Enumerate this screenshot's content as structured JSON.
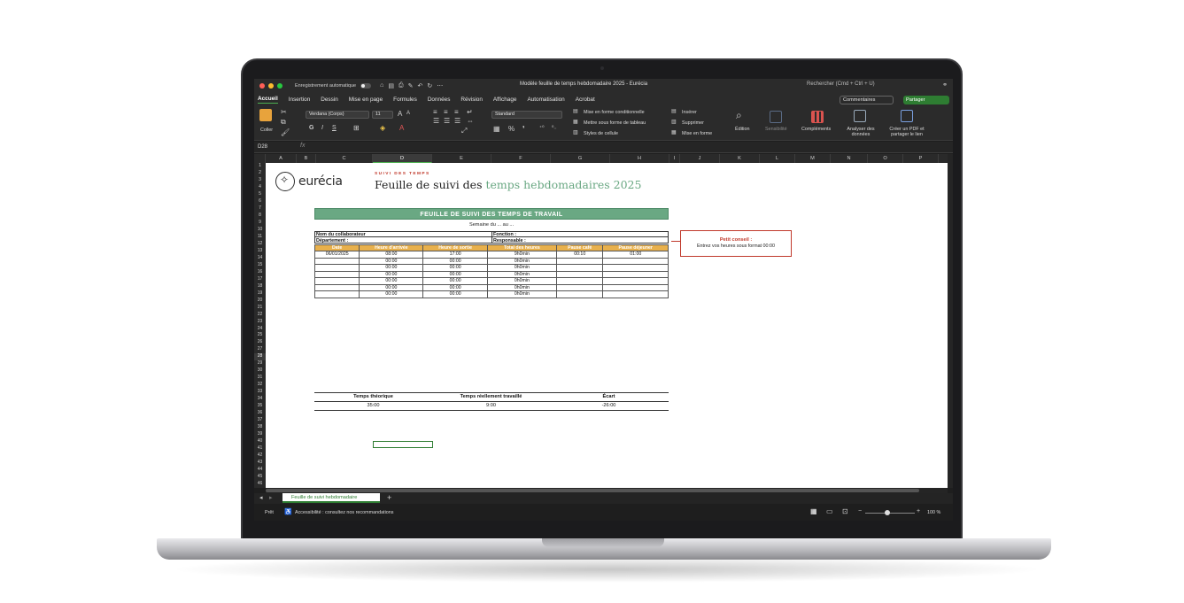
{
  "window": {
    "autosave_label": "Enregistrement automatique",
    "doc_title": "Modèle feuille de temps hebdomadaire 2025 - Eurécia",
    "search_placeholder": "Rechercher (Cmd + Ctrl + U)"
  },
  "ribbon_tabs": [
    "Accueil",
    "Insertion",
    "Dessin",
    "Mise en page",
    "Formules",
    "Données",
    "Révision",
    "Affichage",
    "Automatisation",
    "Acrobat"
  ],
  "ribbon": {
    "comments": "Commentaires",
    "share": "Partager",
    "paste": "Coller",
    "font_name": "Verdana (Corps)",
    "font_size": "11",
    "number_format": "Standard",
    "cond_format": "Mise en forme conditionnelle",
    "table_format": "Mettre sous forme de tableau",
    "cell_styles": "Styles de cellule",
    "insert": "Insérer",
    "delete": "Supprimer",
    "format": "Mise en forme",
    "edition": "Édition",
    "sensitivity": "Sensibilité",
    "addins": "Compléments",
    "analyze": "Analyser des données",
    "pdf": "Créer un PDF et partager le lien"
  },
  "formula_bar": {
    "name_box": "D28",
    "fx": "fx"
  },
  "columns": [
    "A",
    "B",
    "C",
    "D",
    "E",
    "F",
    "G",
    "H",
    "I",
    "J",
    "K",
    "L",
    "M",
    "N",
    "O",
    "P"
  ],
  "rows": [
    "1",
    "2",
    "3",
    "4",
    "5",
    "6",
    "7",
    "8",
    "9",
    "10",
    "11",
    "12",
    "13",
    "14",
    "15",
    "16",
    "17",
    "18",
    "19",
    "20",
    "21",
    "22",
    "23",
    "24",
    "25",
    "26",
    "27",
    "28",
    "29",
    "30",
    "31",
    "32",
    "33",
    "34",
    "35",
    "36",
    "37",
    "38",
    "39",
    "40",
    "41",
    "42",
    "43",
    "44",
    "45",
    "46"
  ],
  "sheet": {
    "logo_text": "eurécia",
    "kicker": "SUIVI DES TEMPS",
    "title_plain": "Feuille de suivi des ",
    "title_accent": "temps hebdomadaires 2025",
    "banner": "FEUILLE DE SUIVI DES TEMPS DE TRAVAIL",
    "week": "Semaine du ... au ...",
    "collaborateur": "Nom du collaborateur",
    "fonction": "Fonction :",
    "departement": "Département :",
    "responsable": "Responsable :",
    "table_headers": [
      "Date",
      "Heure d'arrivée",
      "Heure de sortie",
      "Total des heures",
      "Pause café",
      "Pause déjeuner"
    ],
    "table_rows": [
      [
        "06/01/2025",
        "08:00",
        "17:00",
        "9h0min",
        "00:10",
        "01:00"
      ],
      [
        "",
        "00:00",
        "00:00",
        "0h0min",
        "",
        ""
      ],
      [
        "",
        "00:00",
        "00:00",
        "0h0min",
        "",
        ""
      ],
      [
        "",
        "00:00",
        "00:00",
        "0h0min",
        "",
        ""
      ],
      [
        "",
        "00:00",
        "00:00",
        "0h0min",
        "",
        ""
      ],
      [
        "",
        "00:00",
        "00:00",
        "0h0min",
        "",
        ""
      ],
      [
        "",
        "00:00",
        "00:00",
        "0h0min",
        "",
        ""
      ]
    ],
    "tip_title": "Petit conseil :",
    "tip_text": "Entrez vos heures sous format 00:00",
    "summary_headers": [
      "Temps théorique",
      "Temps réellement travaillé",
      "Écart"
    ],
    "summary_values": [
      "35:00",
      "9:00",
      "-26:00"
    ]
  },
  "sheet_tab": "Feuille de suivi hebdomadaire",
  "status": {
    "ready": "Prêt",
    "accessibility": "Accessibilité : consultez nos recommandations",
    "zoom": "100 %"
  },
  "colors": {
    "accent_green": "#6aa883",
    "header_orange": "#e8b04c",
    "tip_red": "#c0392b",
    "share_green": "#2e7d32"
  }
}
